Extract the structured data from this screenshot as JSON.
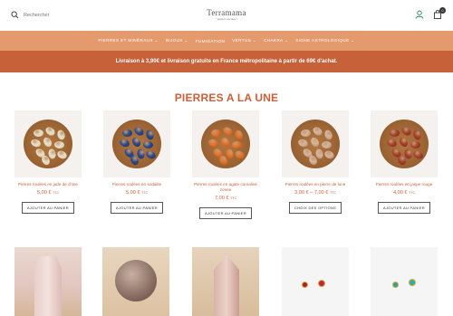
{
  "header": {
    "search_placeholder": "Rechercher",
    "logo_name": "Terramama",
    "logo_tagline": "• pierres sacrées •",
    "cart_count": "0"
  },
  "nav": [
    {
      "label": "Pierres et minéraux ⌄"
    },
    {
      "label": "Bijoux ⌄"
    },
    {
      "label": "Fumigation"
    },
    {
      "label": "Vertus ⌄"
    },
    {
      "label": "Chakra ⌄"
    },
    {
      "label": "Signe astrologique ⌄"
    }
  ],
  "banner": "Livraison à 3,90€ et livraison gratuite en France métropolitaine à partir de 69€ d'achat.",
  "section_title": "PIERRES A LA UNE",
  "products": [
    {
      "name": "Pierres roulées en jade de chine",
      "price": "5,00 €",
      "unit": "TTC",
      "button": "AJOUTER AU PANIER",
      "stone_color": "#e9e0c8",
      "stone_edge": "#cfc3a3"
    },
    {
      "name": "Pierres roulées en sodalite",
      "price": "5,00 €",
      "unit": "TTC",
      "button": "AJOUTER AU PANIER",
      "stone_color": "#2f4a8a",
      "stone_edge": "#1c2f5e"
    },
    {
      "name": "Pierres roulées en agate cornaline zonée",
      "price": "7,00 €",
      "unit": "TTC",
      "button": "AJOUTER AU PANIER",
      "stone_color": "#e4742c",
      "stone_edge": "#b9521a"
    },
    {
      "name": "Pierres roulées en pierre de lune",
      "price": "3,00 € – 7,00 €",
      "unit": "TTC",
      "button": "CHOIX DES OPTIONS",
      "stone_color": "#d8b59a",
      "stone_edge": "#a9806a"
    },
    {
      "name": "Pierres roulées en jaspe rouge",
      "price": "4,00 €",
      "unit": "TTC",
      "button": "AJOUTER AU PANIER",
      "stone_color": "#a8412a",
      "stone_edge": "#7a2a18"
    }
  ]
}
